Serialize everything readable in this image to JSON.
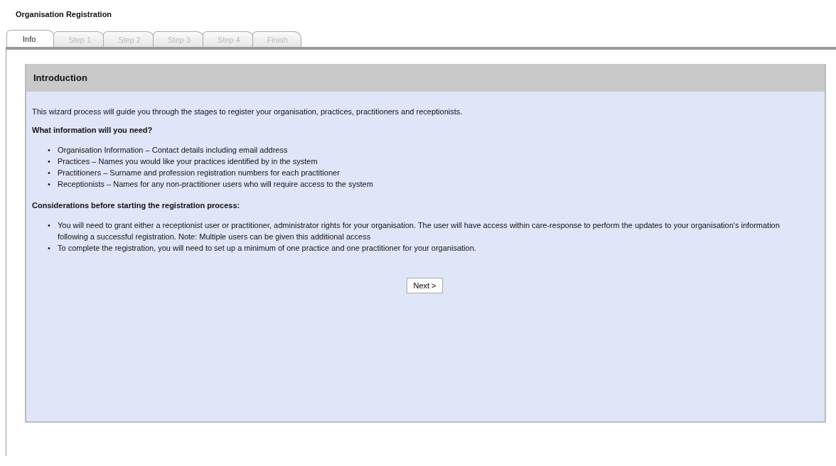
{
  "page_title": "Organisation Registration",
  "tabs": [
    {
      "label": "Info",
      "selected": true
    },
    {
      "label": "Step 1",
      "selected": false
    },
    {
      "label": "Step 2",
      "selected": false
    },
    {
      "label": "Step 3",
      "selected": false
    },
    {
      "label": "Step 4",
      "selected": false
    },
    {
      "label": "Finish",
      "selected": false
    }
  ],
  "panel": {
    "title": "Introduction",
    "intro": "This wizard process will guide you through the stages to register your organisation, practices, practitioners and receptionists.",
    "sections": [
      {
        "heading": "What information will you need?",
        "items": [
          {
            "bullet": "•",
            "text": "Organisation Information – Contact details including email address"
          },
          {
            "bullet": "•",
            "text": "Practices – Names you would like your practices identified by in the system"
          },
          {
            "bullet": "•",
            "text": "Practitioners – Surname and profession registration numbers for each practitioner"
          },
          {
            "bullet": "•",
            "text": "Receptionists – Names for any non-practitioner users who will require access to the system"
          }
        ]
      },
      {
        "heading": "Considerations before starting the registration process:",
        "items": [
          {
            "bullet": "•",
            "text": "You will need to grant either a receptionist user or practitioner, administrator rights for your organisation.  The user will have access within care-response to perform the updates to your organisation's information following a successful registration.  Note:  Multiple users can be given this additional access"
          },
          {
            "bullet": "•",
            "text": "To complete the registration, you will need to set up a minimum of one practice and one practitioner for your organisation."
          }
        ]
      }
    ],
    "next_button": "Next >"
  }
}
